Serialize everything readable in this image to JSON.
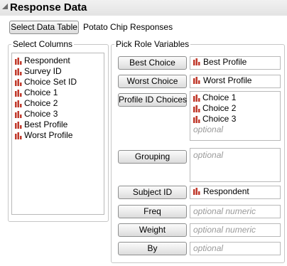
{
  "panel": {
    "title": "Response Data"
  },
  "toolbar": {
    "select_data_table_label": "Select Data Table",
    "data_table_name": "Potato Chip Responses"
  },
  "select_columns": {
    "legend": "Select Columns",
    "columns": [
      "Respondent",
      "Survey ID",
      "Choice Set ID",
      "Choice 1",
      "Choice 2",
      "Choice 3",
      "Best Profile",
      "Worst Profile"
    ]
  },
  "pick_roles": {
    "legend": "Pick Role Variables",
    "best_choice": {
      "button": "Best Choice",
      "value": "Best Profile"
    },
    "worst_choice": {
      "button": "Worst Choice",
      "value": "Worst Profile"
    },
    "profile_id_choices": {
      "button": "Profile ID Choices",
      "values": [
        "Choice 1",
        "Choice 2",
        "Choice 3"
      ],
      "placeholder": "optional"
    },
    "grouping": {
      "button": "Grouping",
      "placeholder": "optional"
    },
    "subject_id": {
      "button": "Subject ID",
      "value": "Respondent"
    },
    "freq": {
      "button": "Freq",
      "placeholder": "optional numeric"
    },
    "weight": {
      "button": "Weight",
      "placeholder": "optional numeric"
    },
    "by": {
      "button": "By",
      "placeholder": "optional"
    }
  },
  "colors": {
    "icon_red": "#c0392b"
  },
  "icons": {
    "column_type": "continuous-column-icon",
    "disclosure": "disclosure-triangle-icon"
  }
}
